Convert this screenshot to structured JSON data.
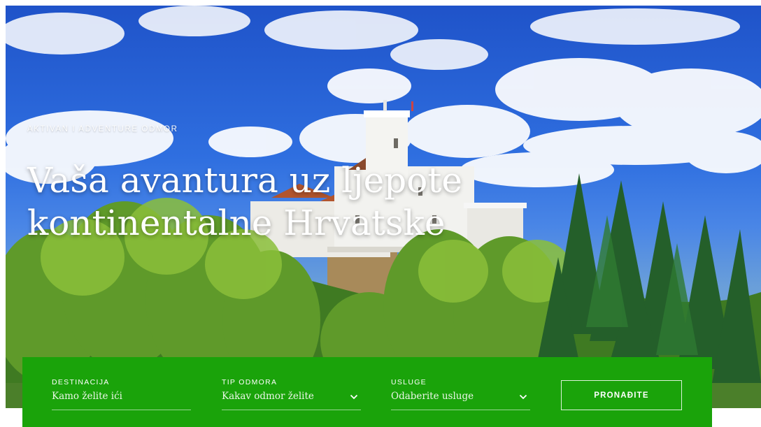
{
  "hero": {
    "kicker": "AKTIVAN I ADVENTURE ODMOR",
    "headline_line1": "Vaša avantura uz ljepote",
    "headline_line2": "kontinentalne Hrvatske"
  },
  "search": {
    "destination": {
      "label": "DESTINACIJA",
      "placeholder": "Kamo želite ići"
    },
    "holiday_type": {
      "label": "TIP ODMORA",
      "value": "Kakav odmor želite",
      "icon": "chevron-down-icon"
    },
    "services": {
      "label": "USLUGE",
      "value": "Odaberite usluge",
      "icon": "chevron-down-icon"
    },
    "submit_label": "PRONAĐITE"
  },
  "colors": {
    "panel_green": "#1aa30a",
    "sky_blue": "#2f6fe0",
    "text_white": "#ffffff"
  }
}
